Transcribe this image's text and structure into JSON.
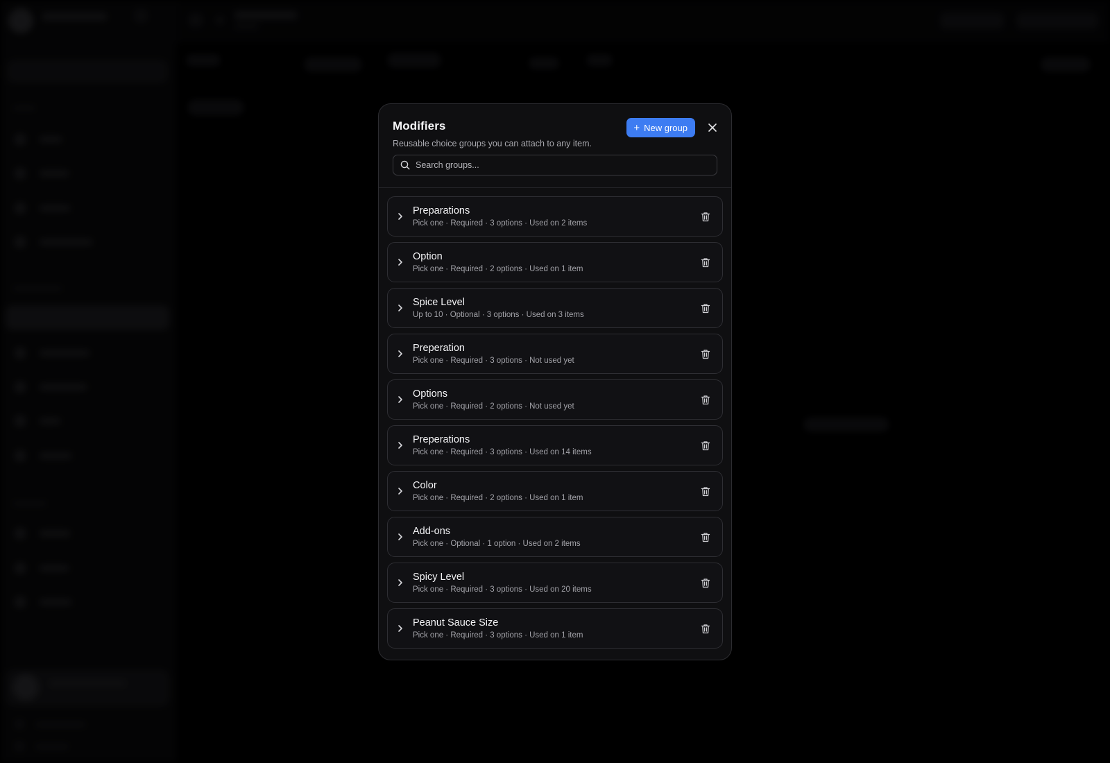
{
  "modal": {
    "title": "Modifiers",
    "subtitle": "Reusable choice groups you can attach to any item.",
    "new_group_label": "New group",
    "new_group_icon": "plus-icon",
    "close_icon": "close-icon",
    "search": {
      "placeholder": "Search groups...",
      "value": "",
      "icon": "search-icon"
    }
  },
  "groups": [
    {
      "name": "Preparations",
      "meta": "Pick one · Required · 3 options · Used on 2 items"
    },
    {
      "name": "Option",
      "meta": "Pick one · Required · 2 options · Used on 1 item"
    },
    {
      "name": "Spice Level",
      "meta": "Up to 10 · Optional · 3 options · Used on 3 items"
    },
    {
      "name": "Preperation",
      "meta": "Pick one · Required · 3 options · Not used yet"
    },
    {
      "name": "Options",
      "meta": "Pick one · Required · 2 options · Not used yet"
    },
    {
      "name": "Preperations",
      "meta": "Pick one · Required · 3 options · Used on 14 items"
    },
    {
      "name": "Color",
      "meta": "Pick one · Required · 2 options · Used on 1 item"
    },
    {
      "name": "Add-ons",
      "meta": "Pick one · Optional · 1 option · Used on 2 items"
    },
    {
      "name": "Spicy Level",
      "meta": "Pick one · Required · 3 options · Used on 20 items"
    },
    {
      "name": "Peanut Sauce Size",
      "meta": "Pick one · Required · 3 options · Used on 1 item"
    }
  ],
  "colors": {
    "accent": "#3d7cf2",
    "modal_bg": "#0f0f11",
    "row_border": "#2e2e33"
  }
}
